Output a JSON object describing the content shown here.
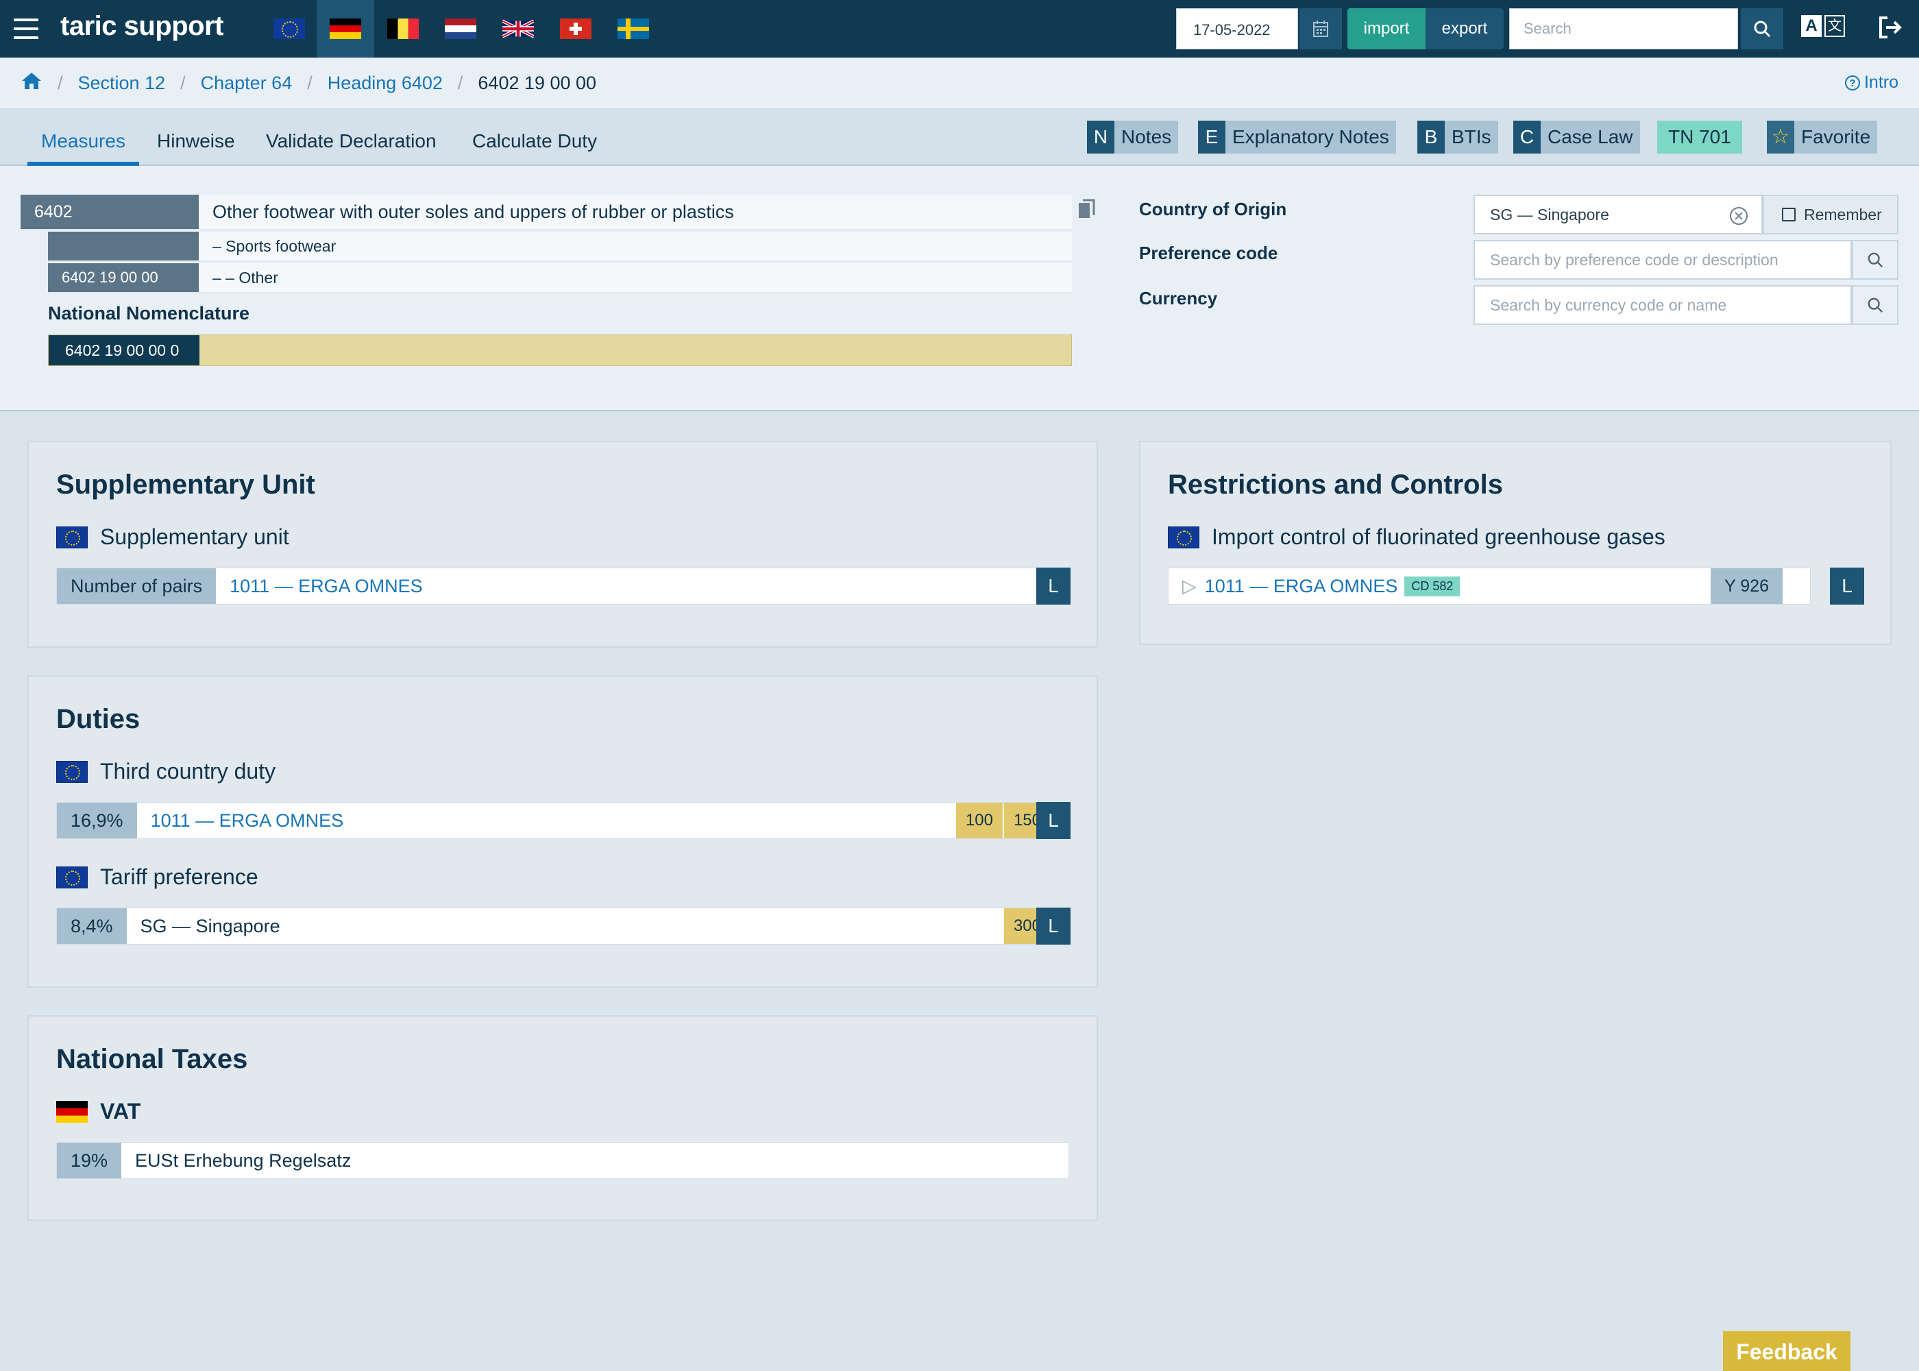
{
  "app": {
    "brand": "taric support"
  },
  "header": {
    "flags": [
      "eu-flag-icon",
      "de-flag-icon",
      "be-flag-icon",
      "nl-flag-icon",
      "uk-flag-icon",
      "ch-flag-icon",
      "se-flag-icon"
    ],
    "active_flag": "de",
    "date": "17-05-2022",
    "import_label": "import",
    "export_label": "export",
    "search_placeholder": "Search"
  },
  "breadcrumb": {
    "items": [
      "Section 12",
      "Chapter 64",
      "Heading 6402"
    ],
    "current": "6402 19 00 00",
    "intro_label": "Intro"
  },
  "tabs": {
    "items": [
      "Measures",
      "Hinweise",
      "Validate Declaration",
      "Calculate Duty"
    ],
    "active": "Measures",
    "chips": [
      {
        "key": "N",
        "label": "Notes"
      },
      {
        "key": "E",
        "label": "Explanatory Notes"
      },
      {
        "key": "B",
        "label": "BTIs"
      },
      {
        "key": "C",
        "label": "Case Law"
      }
    ],
    "tn_label": "TN 701",
    "favorite_label": "Favorite"
  },
  "commodity": {
    "heading_code": "6402",
    "heading_desc": "Other footwear with outer soles and uppers of rubber or plastics",
    "sub1_desc": "–  Sports footwear",
    "sub2_code": "6402 19 00 00",
    "sub2_desc": "– –  Other",
    "national_title": "National Nomenclature",
    "national_code": "6402 19 00 00 0"
  },
  "filters": {
    "origin_label": "Country of Origin",
    "origin_value": "SG — Singapore",
    "remember_label": "Remember",
    "pref_label": "Preference code",
    "pref_placeholder": "Search by preference code or description",
    "currency_label": "Currency",
    "currency_placeholder": "Search by currency code or name"
  },
  "supplementary": {
    "title": "Supplementary Unit",
    "sub_title": "Supplementary unit",
    "lead": "Number of pairs",
    "text": "1011 — ERGA OMNES",
    "l": "L"
  },
  "restrictions": {
    "title": "Restrictions and Controls",
    "sub_title": "Import control of fluorinated greenhouse gases",
    "text": "1011 — ERGA OMNES",
    "badge": "CD 582",
    "code": "Y 926",
    "l": "L"
  },
  "duties": {
    "title": "Duties",
    "third": {
      "sub_title": "Third country duty",
      "rate": "16,9%",
      "text": "1011 — ERGA OMNES",
      "footnotes": [
        "100",
        "150"
      ],
      "l": "L"
    },
    "pref": {
      "sub_title": "Tariff preference",
      "rate": "8,4%",
      "text": "SG — Singapore",
      "footnotes": [
        "300"
      ],
      "l": "L"
    }
  },
  "taxes": {
    "title": "National Taxes",
    "sub_title": "VAT",
    "rate": "19%",
    "text": "EUSt Erhebung Regelsatz"
  },
  "feedback_label": "Feedback"
}
